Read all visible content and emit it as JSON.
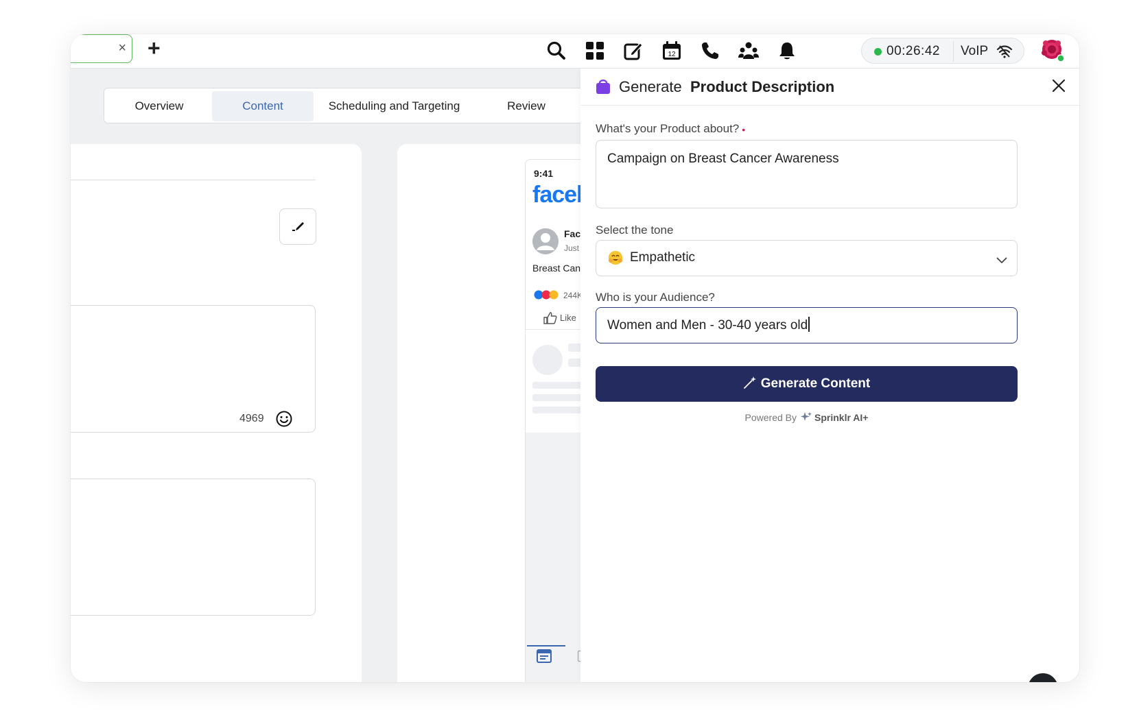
{
  "topbar": {
    "tab_close": "×",
    "new_tab": "+",
    "timer": {
      "time": "00:26:42",
      "voip": "VoIP",
      "status_color": "#2db84d"
    },
    "icons": [
      "search-icon",
      "apps-grid-icon",
      "compose-icon",
      "calendar-icon",
      "phone-icon",
      "community-icon",
      "bell-icon",
      "wifi-off-icon"
    ],
    "calendar_day": "12"
  },
  "steps": [
    {
      "label": "Overview",
      "active": false
    },
    {
      "label": "Content",
      "active": true
    },
    {
      "label": "Scheduling and Targeting",
      "active": false
    },
    {
      "label": "Review",
      "active": false
    }
  ],
  "editor": {
    "char_count": "4969"
  },
  "preview": {
    "clock": "9:41",
    "brand": "faceb",
    "page_name": "Face",
    "post_time": "Just",
    "post_text": "Breast Can",
    "reaction_count": "244K",
    "like_label": "Like"
  },
  "drawer": {
    "title_prefix": "Generate",
    "title": "Product Description",
    "product_label": "What's your Product about?",
    "required_mark": "•",
    "product_value": "Campaign on Breast Cancer Awareness",
    "tone_label": "Select the tone",
    "tone_value": "Empathetic",
    "audience_label": "Who is your Audience?",
    "audience_value": "Women and Men - 30-40 years old",
    "generate_label": "Generate Content",
    "powered_prefix": "Powered By",
    "powered_brand": "Sprinklr AI+",
    "accent_color": "#242b5e"
  }
}
